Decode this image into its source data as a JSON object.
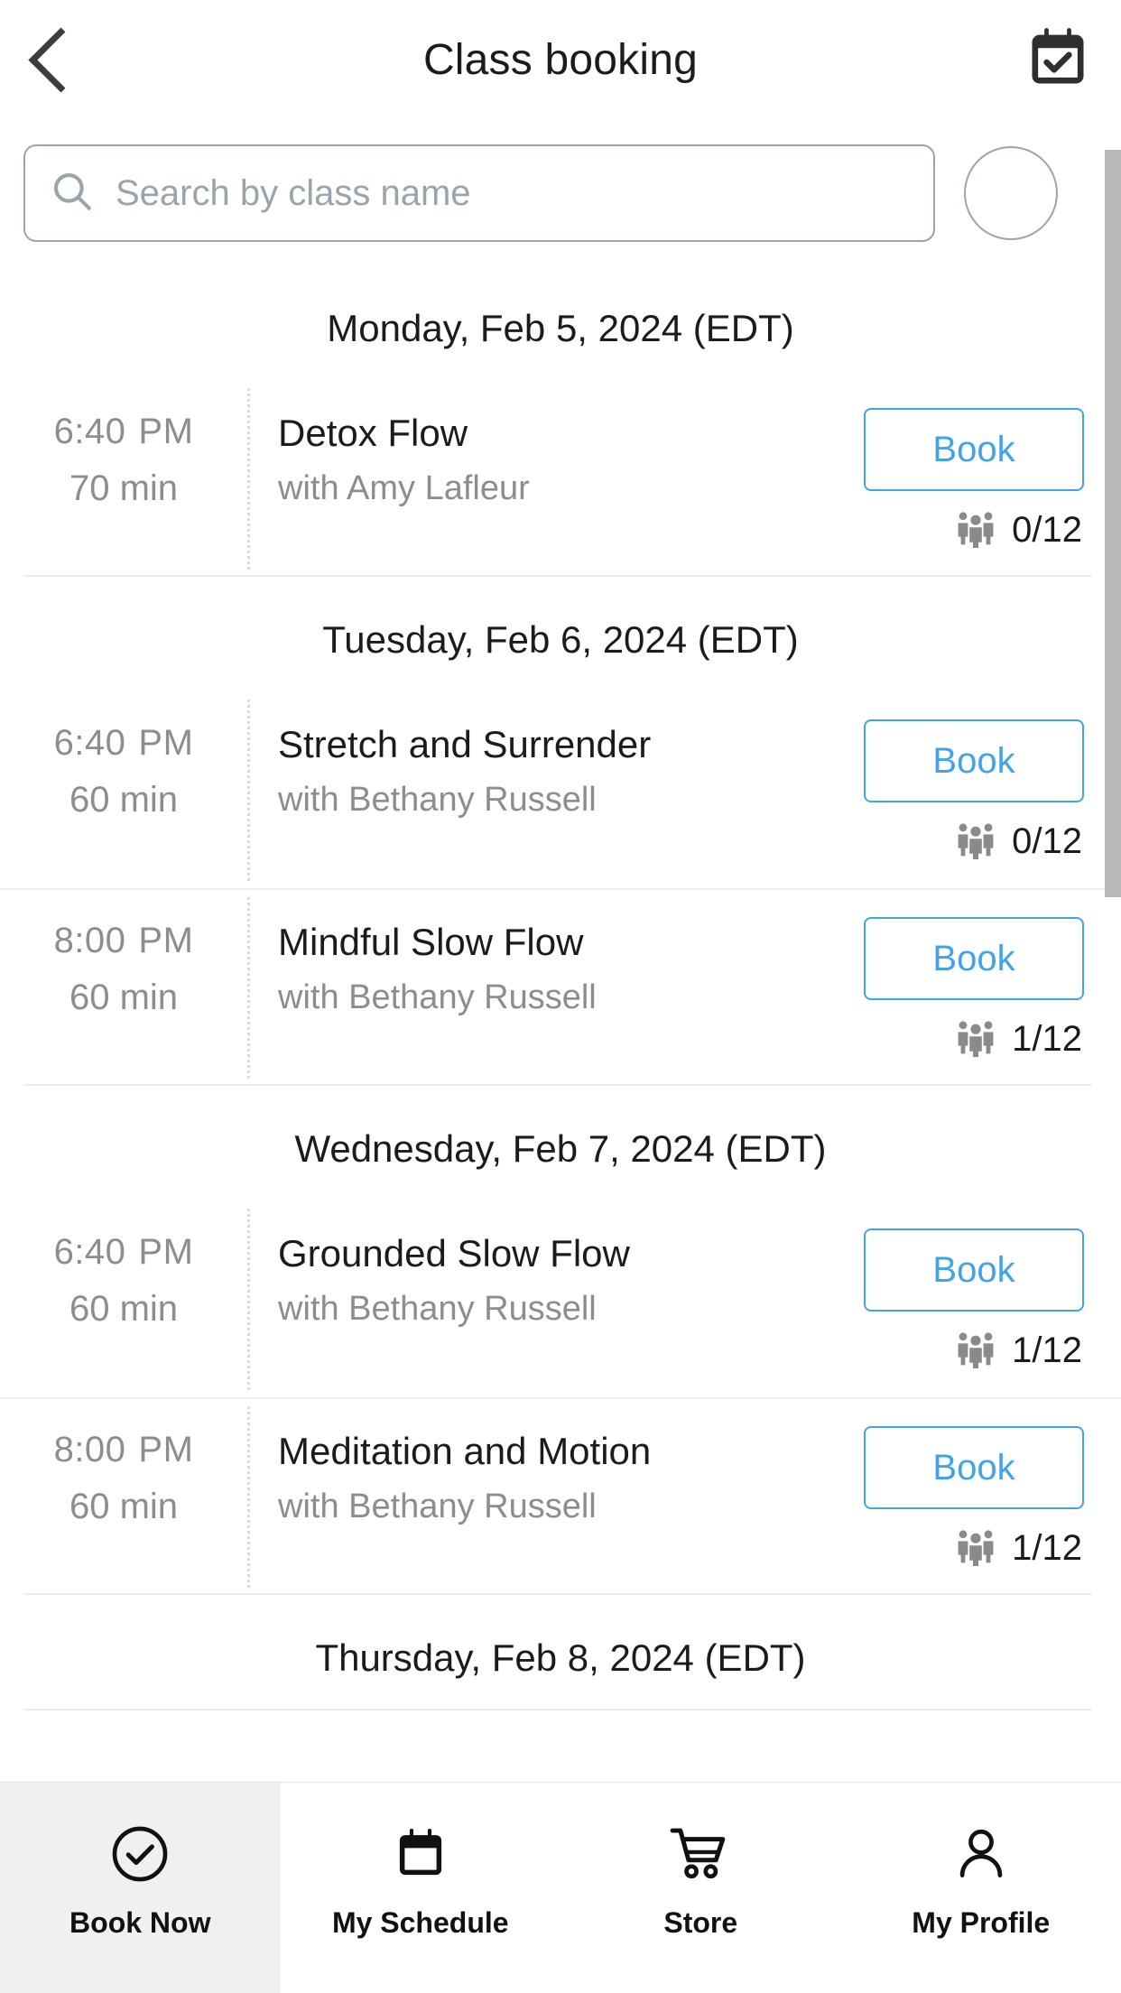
{
  "header": {
    "title": "Class booking",
    "back_icon": "chevron-left-icon",
    "action_icon": "calendar-check-icon"
  },
  "search": {
    "placeholder": "Search by class name",
    "value": "",
    "icon": "search-icon",
    "avatar_icon": "avatar-circle-icon"
  },
  "colors": {
    "accent": "#3fa4e8",
    "text": "#1b1b1b",
    "muted": "#8d8d8d",
    "border": "#9aa4ab",
    "divider": "#ececec",
    "active_tab_bg": "#f0f0f0"
  },
  "schedule": [
    {
      "day_label": "Monday, Feb 5, 2024 (EDT)",
      "classes": [
        {
          "time": "6:40",
          "ampm": "PM",
          "duration": "70 min",
          "name": "Detox Flow",
          "teacher": "with Amy Lafleur",
          "book_label": "Book",
          "capacity": "0/12",
          "capacity_icon": "people-group-icon"
        }
      ]
    },
    {
      "day_label": "Tuesday, Feb 6, 2024 (EDT)",
      "classes": [
        {
          "time": "6:40",
          "ampm": "PM",
          "duration": "60 min",
          "name": "Stretch and Surrender",
          "teacher": "with Bethany Russell",
          "book_label": "Book",
          "capacity": "0/12",
          "capacity_icon": "people-group-icon"
        },
        {
          "time": "8:00",
          "ampm": "PM",
          "duration": "60 min",
          "name": "Mindful Slow Flow",
          "teacher": "with Bethany Russell",
          "book_label": "Book",
          "capacity": "1/12",
          "capacity_icon": "people-group-icon"
        }
      ]
    },
    {
      "day_label": "Wednesday, Feb 7, 2024 (EDT)",
      "classes": [
        {
          "time": "6:40",
          "ampm": "PM",
          "duration": "60 min",
          "name": "Grounded Slow Flow",
          "teacher": "with Bethany Russell",
          "book_label": "Book",
          "capacity": "1/12",
          "capacity_icon": "people-group-icon"
        },
        {
          "time": "8:00",
          "ampm": "PM",
          "duration": "60 min",
          "name": "Meditation and Motion",
          "teacher": "with Bethany Russell",
          "book_label": "Book",
          "capacity": "1/12",
          "capacity_icon": "people-group-icon"
        }
      ]
    },
    {
      "day_label": "Thursday, Feb 8, 2024 (EDT)",
      "classes": []
    }
  ],
  "bottom_nav": {
    "items": [
      {
        "label": "Book Now",
        "icon": "check-circle-icon",
        "active": true
      },
      {
        "label": "My Schedule",
        "icon": "calendar-icon",
        "active": false
      },
      {
        "label": "Store",
        "icon": "shopping-cart-icon",
        "active": false
      },
      {
        "label": "My Profile",
        "icon": "person-icon",
        "active": false
      }
    ]
  }
}
